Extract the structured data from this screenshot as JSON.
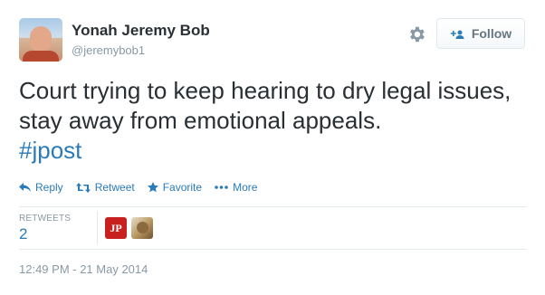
{
  "author": {
    "name": "Yonah Jeremy Bob",
    "handle": "@jeremybob1"
  },
  "header": {
    "settings_icon": "gear-icon",
    "follow_label": "Follow",
    "follow_icon": "follow-user-plus-icon"
  },
  "tweet": {
    "text": "Court trying to keep hearing to dry legal issues, stay away from emotional appeals.",
    "hashtag": "#jpost"
  },
  "actions": [
    {
      "label": "Reply",
      "icon": "reply-icon"
    },
    {
      "label": "Retweet",
      "icon": "retweet-icon"
    },
    {
      "label": "Favorite",
      "icon": "star-icon"
    },
    {
      "label": "More",
      "icon": "more-dots-icon"
    }
  ],
  "stats": {
    "retweets_label": "RETWEETS",
    "retweets_count": "2"
  },
  "retweeters": [
    {
      "name": "jpost-avatar",
      "glyph": "JP"
    },
    {
      "name": "dog-avatar"
    }
  ],
  "timestamp": "12:49 PM - 21 May 2014",
  "colors": {
    "link_blue": "#2b7bb9",
    "muted_gray": "#8899a6",
    "text_dark": "#292f33",
    "border": "#e1e8ed",
    "jpost_red": "#c8201f"
  }
}
